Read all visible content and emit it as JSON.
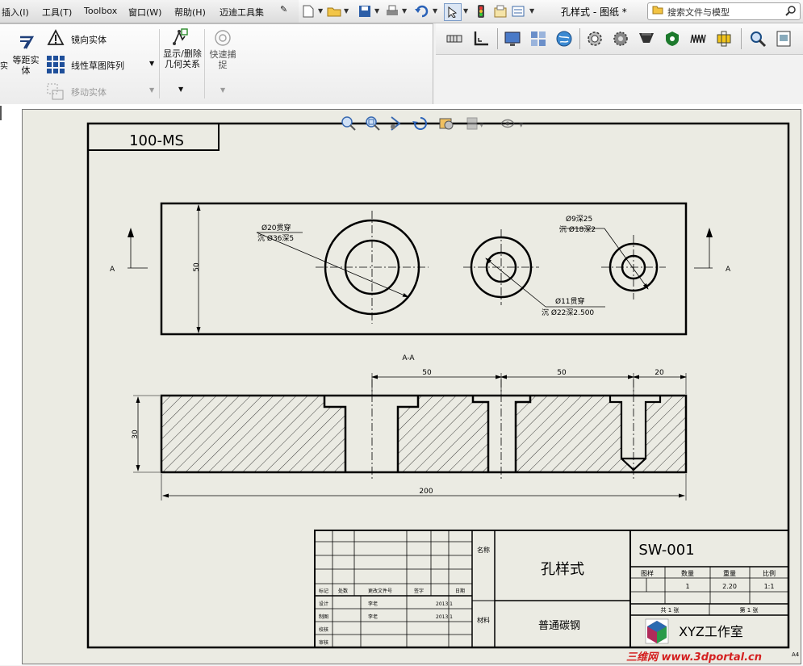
{
  "menu": {
    "items": [
      "插入(I)",
      "工具(T)",
      "Toolbox",
      "窗口(W)",
      "帮助(H)",
      "迈迪工具集"
    ]
  },
  "titlebar": {
    "document_title": "孔样式 - 图纸 *",
    "search_placeholder": "搜索文件与模型"
  },
  "command_manager": {
    "offset_entities": "等距实体",
    "mirror_entities": "镜向实体",
    "linear_pattern": "线性草图阵列",
    "move_entities": "移动实体",
    "display_relations": "显示/删除几何关系",
    "quick_snaps": "快速捕捉"
  },
  "right_toolbar": {
    "icons": [
      "dimension-icon",
      "angle-icon",
      "monitor-icon",
      "assembly-icon",
      "globe-icon",
      "gear-icon",
      "gear2-icon",
      "funnel-icon",
      "shield-icon",
      "spring-icon",
      "bracket-icon",
      "zoom-icon",
      "print-icon"
    ]
  },
  "drawing": {
    "part_label": "100-MS",
    "section_view_label": "A-A",
    "arrow_label_left": "A",
    "arrow_label_right": "A",
    "callout_large": {
      "line1": "Ø20贯穿",
      "line2": "沉 Ø36深5"
    },
    "callout_small": {
      "line1": "Ø9深25",
      "line2": "沉 Ø18深2"
    },
    "callout_mid": {
      "line1": "Ø11贯穿",
      "line2": "沉 Ø22深2.500"
    },
    "dim_height_top": "50",
    "dim_height_section": "30",
    "dim_50_a": "50",
    "dim_50_b": "50",
    "dim_20": "20",
    "dim_200": "200"
  },
  "title_block": {
    "drawing_number": "SW-001",
    "part_name": "孔样式",
    "material": "普通碳钢",
    "studio": "XYZ工作室",
    "name_label": "名称",
    "material_label": "材料",
    "stage_label": "图样",
    "qty_label": "数量",
    "weight_label": "重量",
    "scale_label": "比例",
    "qty_value": "1",
    "weight_value": "2.20",
    "scale_value": "1:1",
    "sheets_total": "共 1 张",
    "sheet_num": "第 1 张",
    "rev_headers": [
      "标记",
      "处数",
      "更改文件号",
      "签字",
      "日期"
    ],
    "sign_rows": [
      {
        "role": "设计",
        "name": "李老",
        "date": "2013.1"
      },
      {
        "role": "制图",
        "name": "李老",
        "date": "2013.1"
      },
      {
        "role": "校核",
        "name": "",
        "date": ""
      },
      {
        "role": "审核",
        "name": "",
        "date": ""
      }
    ],
    "sheet_size": "A4"
  },
  "watermark": "三维网 www.3dportal.cn"
}
